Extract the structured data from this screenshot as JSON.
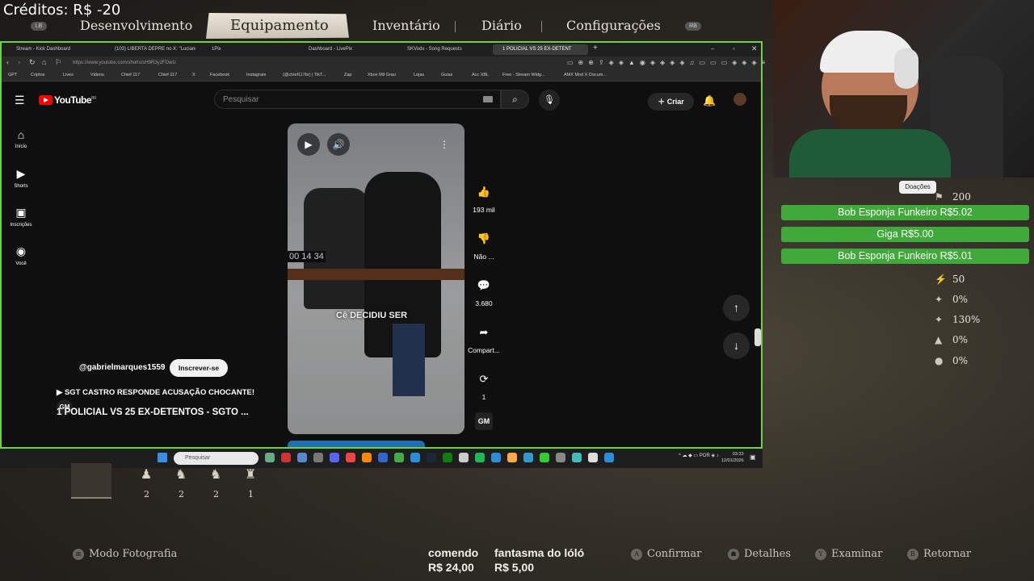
{
  "game": {
    "credits": "Créditos: R$ -20",
    "lb": "LB",
    "rb": "RB",
    "tabs": [
      "Desenvolvimento",
      "Equipamento",
      "Inventário",
      "Diário",
      "Configurações"
    ],
    "active_tab": "Equipamento",
    "inventory": [
      {
        "icon": "♟",
        "count": "2"
      },
      {
        "icon": "♞",
        "count": "2"
      },
      {
        "icon": "♞",
        "count": "2"
      },
      {
        "icon": "♜",
        "count": "1"
      }
    ],
    "prompts": {
      "photo": "Modo Fotografia",
      "confirm": "Confirmar",
      "details": "Detalhes",
      "examine": "Examinar",
      "back": "Retornar"
    },
    "prompt_keys": {
      "photo": "⊞",
      "confirm": "A",
      "details": "☗",
      "examine": "Y",
      "back": "B"
    }
  },
  "browser": {
    "tabs": [
      "Stream - Kick Dashboard",
      "(103) LIBERTA DEPRE no X: \"Luciano",
      "1Pix",
      "Dashboard - LivePix",
      "SKVods - Song Requests",
      "1 POLICIAL VS 25 EX-DETENT"
    ],
    "new_tab": "+",
    "url": "https://www.youtube.com/shorts/sH9R3y2FDwU",
    "bookmarks": [
      "GPT",
      "Criptos",
      "Lives",
      "Videos",
      "Chief 117",
      "Chief 117",
      "X",
      "Facebook",
      "Instagram",
      "(@chief117br) | TikT...",
      "Zap",
      "Xbox Mil Grau",
      "Lojas",
      "Guias",
      "Acc XBL",
      "Free - Stream Widg...",
      "AMX Mod X Docum..."
    ]
  },
  "youtube": {
    "logo": "YouTube",
    "region": "BR",
    "search_placeholder": "Pesquisar",
    "create": "Criar",
    "nav": [
      {
        "icon": "⌂",
        "label": "Início"
      },
      {
        "icon": "▶",
        "label": "Shorts"
      },
      {
        "icon": "▣",
        "label": "Inscrições"
      },
      {
        "icon": "◉",
        "label": "Você"
      }
    ],
    "caption": "Cê DECIDIU SER",
    "timer": "00 14 34",
    "actions": [
      {
        "icon": "👍",
        "label": "193 mil"
      },
      {
        "icon": "👎",
        "label": "Não ..."
      },
      {
        "icon": "💬",
        "label": "3.680"
      },
      {
        "icon": "➦",
        "label": "Compart..."
      },
      {
        "icon": "⟳",
        "label": "1"
      }
    ],
    "channel": "@gabrielmarques1559",
    "subscribe": "Inscrever-se",
    "song": "▶ SGT CASTRO RESPONDE ACUSAÇÃO CHOCANTE!",
    "title": "1 POLICIAL VS 25 EX-DETENTOS - SGTO ..."
  },
  "taskbar": {
    "search": "Pesquisar",
    "lang": "POR",
    "time": "03:33",
    "date": "12/01/2026"
  },
  "overlay": {
    "donations_label": "Doações",
    "donations": [
      "Bob Esponja Funkeiro R$5.02",
      "Giga R$5.00",
      "Bob Esponja Funkeiro R$5.01"
    ],
    "stats": [
      {
        "icon": "⚑",
        "value": "200"
      },
      {
        "icon": "⚡",
        "value": "50"
      },
      {
        "icon": "✦",
        "value": "0%"
      },
      {
        "icon": "✦",
        "value": "130%"
      },
      {
        "icon": "▲",
        "value": "0%"
      },
      {
        "icon": "●",
        "value": "0%"
      }
    ],
    "tips": [
      {
        "name": "comendo",
        "amount": "R$ 24,00"
      },
      {
        "name": "fantasma do lóló",
        "amount": "R$ 5,00"
      }
    ]
  },
  "colors": {
    "accent_green": "#3faa3a",
    "youtube_red": "#ff0000",
    "browser_border": "#6fd14a"
  }
}
